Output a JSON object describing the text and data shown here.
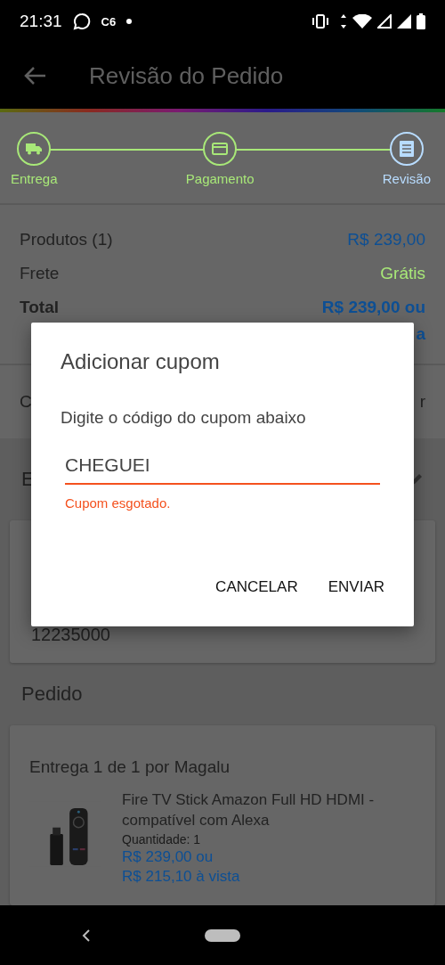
{
  "status_bar": {
    "time": "21:31",
    "carrier_badge": "C6"
  },
  "app_bar": {
    "title": "Revisão do Pedido"
  },
  "steps": [
    {
      "label": "Entrega",
      "selected": false
    },
    {
      "label": "Pagamento",
      "selected": false
    },
    {
      "label": "Revisão",
      "selected": true
    }
  ],
  "summary": {
    "rows": [
      {
        "label": "Produtos (1)",
        "value": "R$ 239,00",
        "kind": "price"
      },
      {
        "label": "Frete",
        "value": "Grátis",
        "kind": "free"
      },
      {
        "label": "Total",
        "value": "R$ 239,00 ou",
        "kind": "total"
      }
    ],
    "total_continuation": "a"
  },
  "coupon_row": {
    "label": "C",
    "action": "r"
  },
  "address": {
    "heading": "E",
    "postal_code": "12235000"
  },
  "order": {
    "heading": "Pedido",
    "shipment_title": "Entrega 1 de 1 por Magalu",
    "product": {
      "kind": "picture",
      "name": "Fire TV Stick Amazon Full HD HDMI - compatível com Alexa",
      "quantity_label": "Quantidade:",
      "quantity": "1",
      "price": "R$ 239,00 ou",
      "cash_price": "R$ 215,10 à vista"
    }
  },
  "dialog": {
    "title": "Adicionar cupom",
    "message": "Digite o código do cupom abaixo",
    "input": {
      "value": "CHEGUEI",
      "error": "Cupom esgotado."
    },
    "buttons": [
      "CANCELAR",
      "ENVIAR"
    ]
  }
}
